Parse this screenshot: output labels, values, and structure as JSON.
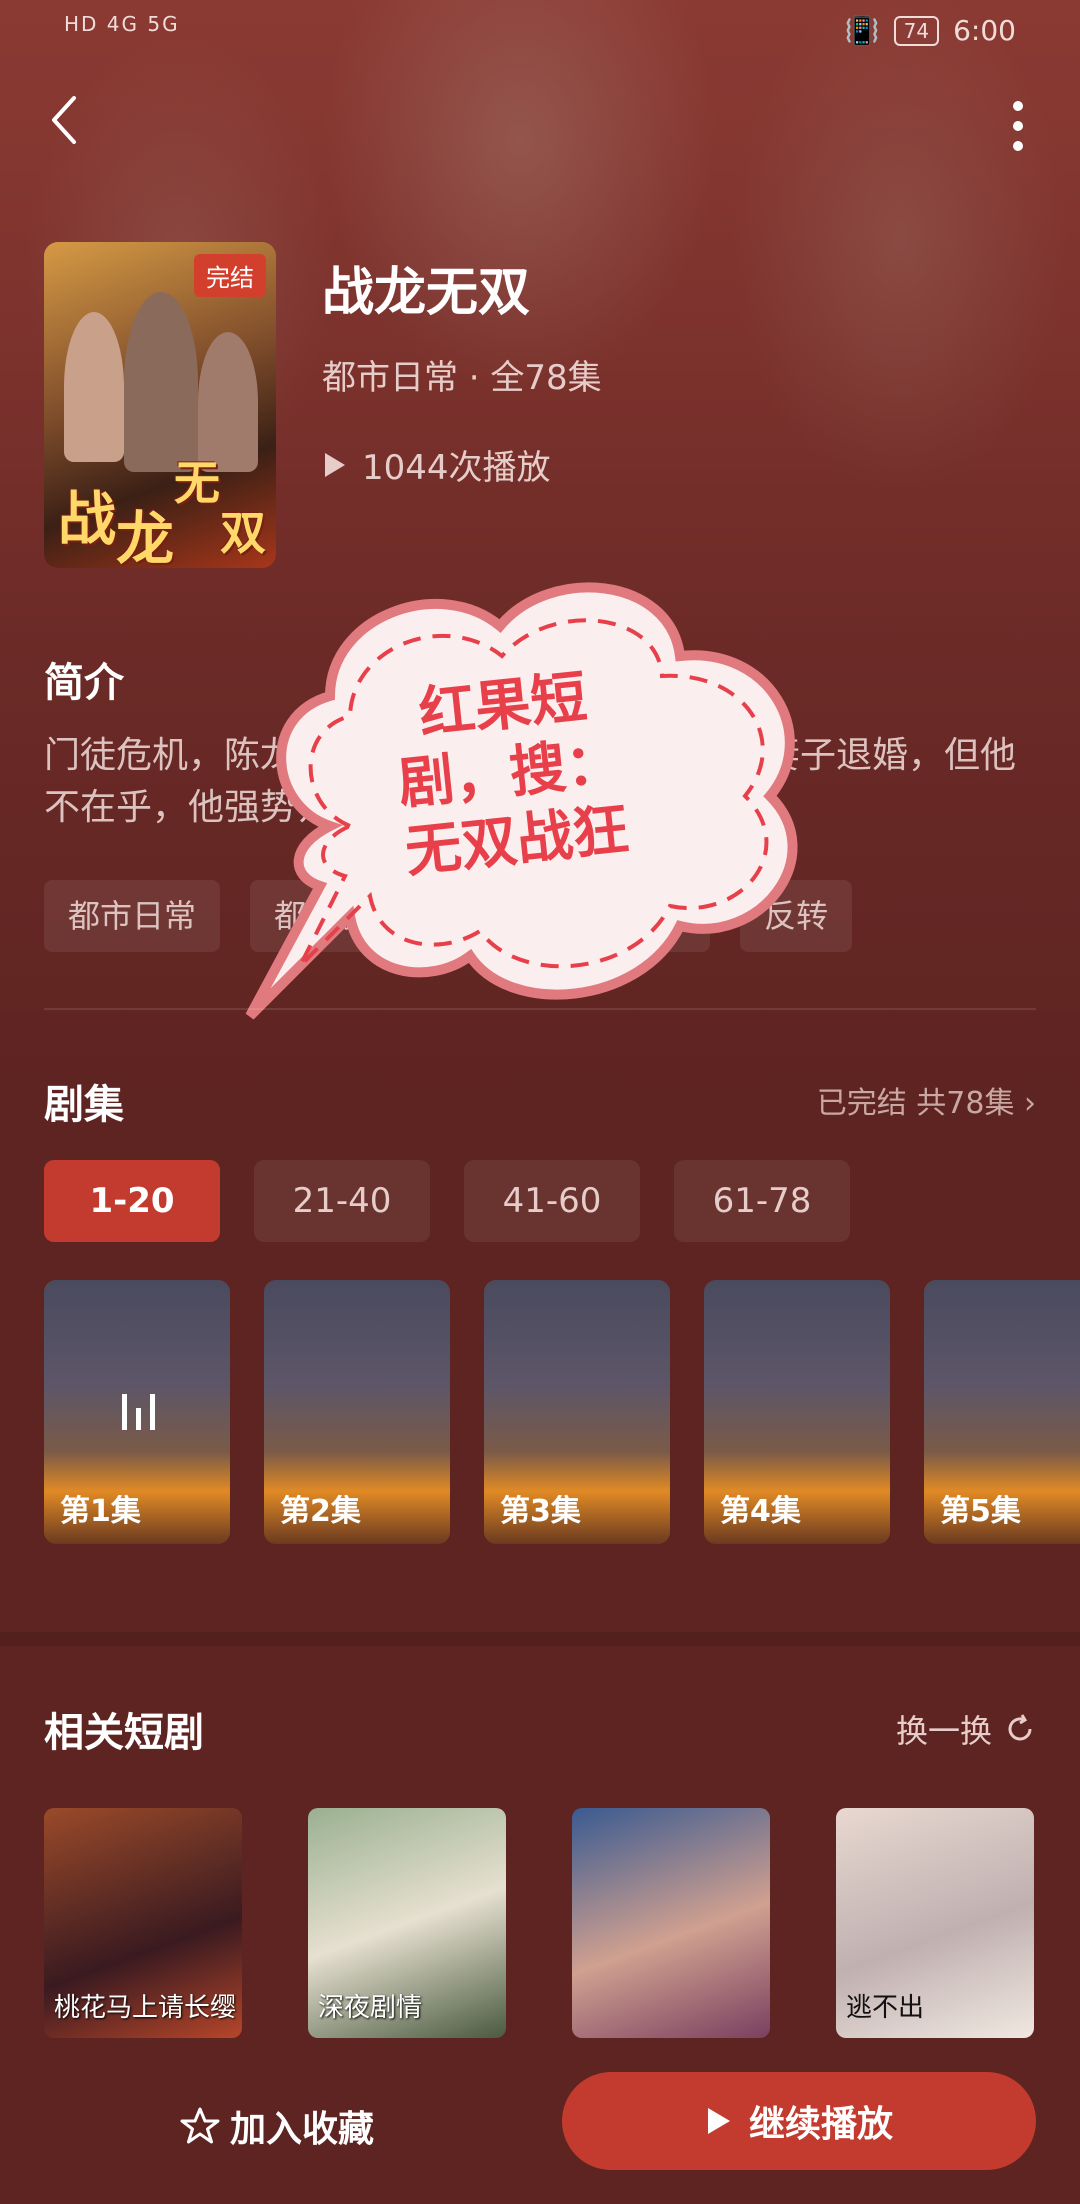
{
  "status": {
    "signal": "HD 4G 5G",
    "battery": "74",
    "time": "6:00"
  },
  "drama": {
    "title": "战龙无双",
    "badge": "完结",
    "poster_title_1": "战",
    "poster_title_2": "龙",
    "poster_title_3": "无",
    "poster_title_4": "双",
    "meta": "都市日常 · 全78集",
    "plays": "1044次播放"
  },
  "intro": {
    "heading": "简介",
    "text": "门徒危机，陈龙从天而降解决危机，突然发现妻子退婚，但他不在乎，他强势归来，你是英雄。",
    "tags": [
      "都市日常",
      "都市脑洞",
      "战神",
      "逆袭",
      "反转"
    ]
  },
  "sticker": {
    "line1": "红果短",
    "line2": "剧，搜：",
    "line3": "无双战狂"
  },
  "episodes": {
    "heading": "剧集",
    "summary": "已完结 共78集 ›",
    "ranges": [
      "1-20",
      "21-40",
      "41-60",
      "61-78"
    ],
    "items": [
      "第1集",
      "第2集",
      "第3集",
      "第4集",
      "第5集"
    ]
  },
  "related": {
    "heading": "相关短剧",
    "refresh": "换一换",
    "items": [
      "桃花马上请长缨",
      "深夜剧情",
      "",
      "逃不出"
    ]
  },
  "actions": {
    "favorite": "加入收藏",
    "continue": "继续播放"
  },
  "colors": {
    "accent": "#c23b2e",
    "background": "#5e2421",
    "sticker": "#e8404a"
  }
}
